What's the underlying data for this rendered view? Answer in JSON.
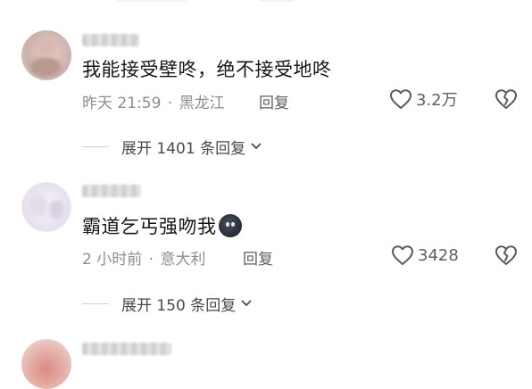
{
  "comments": [
    {
      "content": "我能接受壁咚，绝不接受地咚",
      "time": "昨天 21:59",
      "location": "黑龙江",
      "reply_label": "回复",
      "likes": "3.2万",
      "expand_label": "展开 1401 条回复"
    },
    {
      "content": "霸道乞丐强吻我",
      "time": "2 小时前",
      "location": "意大利",
      "reply_label": "回复",
      "likes": "3428",
      "expand_label": "展开 150 条回复"
    }
  ],
  "colors": {
    "text_primary": "#161616",
    "text_meta": "#8e8e8e",
    "icon_stroke": "#5a5a5a"
  },
  "icons": {
    "like": "heart-outline-icon",
    "dislike": "broken-heart-icon",
    "expand": "chevron-down-icon"
  }
}
